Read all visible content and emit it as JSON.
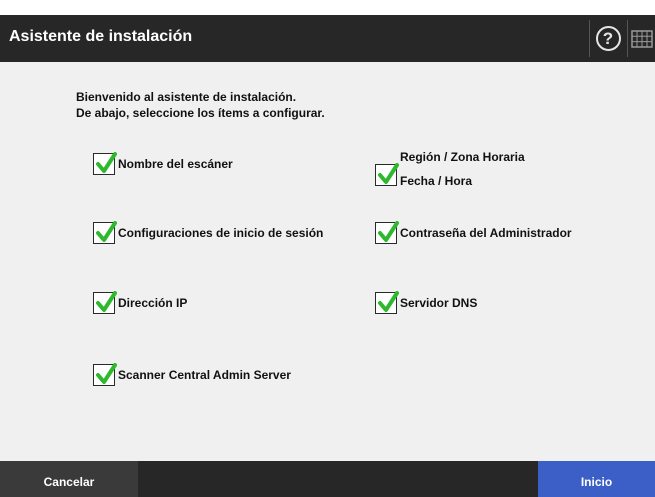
{
  "header": {
    "title": "Asistente de instalación",
    "help_icon": "help-icon",
    "help_glyph": "?",
    "keyboard_icon": "keyboard-icon"
  },
  "intro": {
    "line1": "Bienvenido al asistente de instalación.",
    "line2": "De abajo, seleccione los ítems a configurar."
  },
  "items": [
    {
      "label": "Nombre del escáner",
      "checked": true
    },
    {
      "label": "Configuraciones de inicio de sesión",
      "checked": true
    },
    {
      "label": "Dirección IP",
      "checked": true
    },
    {
      "label": "Scanner Central Admin Server",
      "checked": true
    },
    {
      "labels": [
        "Región / Zona Horaria",
        "Fecha / Hora"
      ],
      "checked": true
    },
    {
      "label": "Contraseña del Administrador",
      "checked": true
    },
    {
      "label": "Servidor DNS",
      "checked": true
    }
  ],
  "footer": {
    "cancel_label": "Cancelar",
    "start_label": "Inicio"
  },
  "colors": {
    "titlebar": "#272727",
    "content_bg": "#f0f0f0",
    "check": "#2eb82e",
    "start_button": "#3b5fc6"
  }
}
